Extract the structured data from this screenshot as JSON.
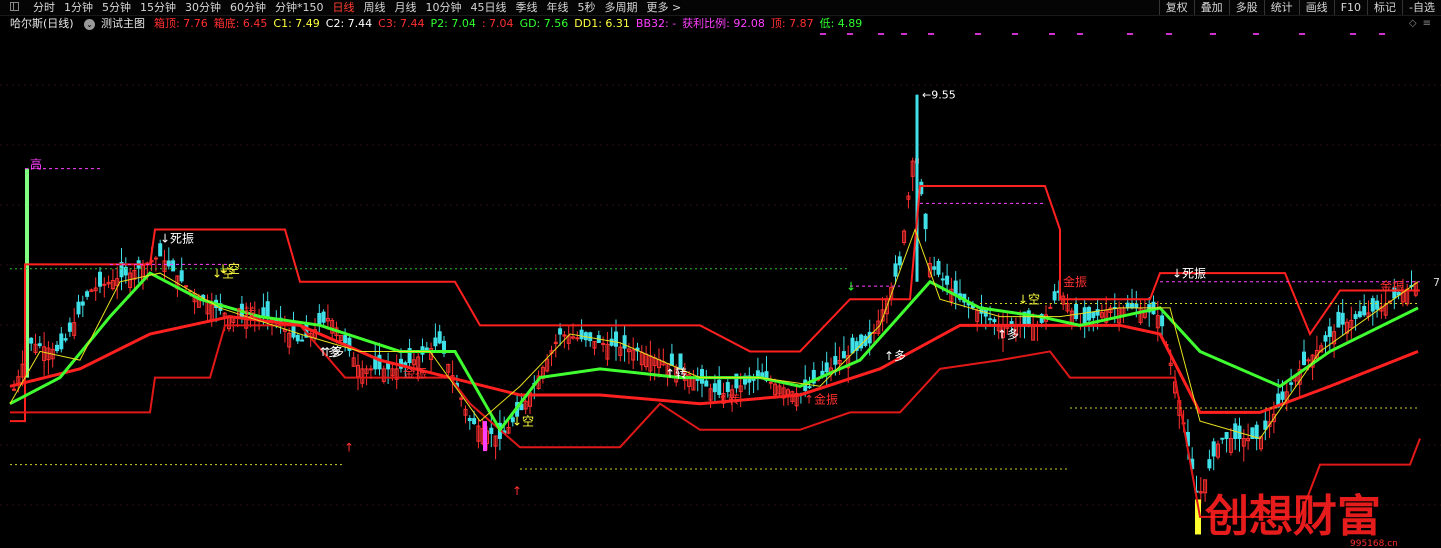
{
  "toolbar": {
    "periods": [
      "分时",
      "1分钟",
      "5分钟",
      "15分钟",
      "30分钟",
      "60分钟",
      "分钟*150",
      "日线",
      "周线",
      "月线",
      "10分钟",
      "45日线",
      "季线",
      "年线",
      "5秒",
      "多周期",
      "更多 >"
    ],
    "active_period": "日线",
    "right_tools": [
      "复权",
      "叠加",
      "多股",
      "统计",
      "画线",
      "F10",
      "标记",
      "-自选"
    ]
  },
  "legend": {
    "stock": "哈尔斯(日线)",
    "main": "测试主图",
    "items": [
      {
        "text": "箱顶: 7.76",
        "color": "#ff3030"
      },
      {
        "text": "箱底: 6.45",
        "color": "#ff3030"
      },
      {
        "text": "C1: 7.49",
        "color": "#ffff40"
      },
      {
        "text": "C2: 7.44",
        "color": "#ffffff"
      },
      {
        "text": "C3: 7.44",
        "color": "#ff3030"
      },
      {
        "text": "P2: 7.04",
        "color": "#30ff30"
      },
      {
        "text": ": 7.04",
        "color": "#ff3030"
      },
      {
        "text": "GD: 7.56",
        "color": "#30ff30"
      },
      {
        "text": "DD1: 6.31",
        "color": "#ffff40"
      },
      {
        "text": "BB32: -",
        "color": "#ff40ff"
      },
      {
        "text": "获利比例: 92.08",
        "color": "#ff40ff"
      },
      {
        "text": "顶: 7.87",
        "color": "#ff3030"
      },
      {
        "text": "低: 4.89",
        "color": "#30ff30"
      }
    ],
    "controls": [
      "◇",
      "≡"
    ]
  },
  "chart_data": {
    "type": "candlestick",
    "high_label": "9.55",
    "axis_value": "7",
    "annotations": [
      {
        "text": "高",
        "color": "#ff40ff"
      },
      {
        "text": "↓死振",
        "color": "#ffffff"
      },
      {
        "text": "↓空",
        "color": "#ffff40"
      },
      {
        "text": "↑多",
        "color": "#ffffff"
      },
      {
        "text": "↓空",
        "color": "#ffff40"
      },
      {
        "text": "↑多",
        "color": "#ffffff"
      },
      {
        "text": "↑多",
        "color": "#ffffff"
      },
      {
        "text": "↓空",
        "color": "#ffff40"
      },
      {
        "text": "↑多",
        "color": "#ffffff"
      },
      {
        "text": "↓死振",
        "color": "#ffffff"
      },
      {
        "text": "金振",
        "color": "#ff3030"
      },
      {
        "text": "金振",
        "color": "#ff3030"
      },
      {
        "text": "↑金振",
        "color": "#ff3030"
      },
      {
        "text": "↑转",
        "color": "#ff3030"
      },
      {
        "text": "↑转",
        "color": "#ff3030"
      },
      {
        "text": "↑转",
        "color": "#ffffff"
      },
      {
        "text": "金振",
        "color": "#ff3030"
      },
      {
        "text": "↓空",
        "color": "#ffff40"
      }
    ],
    "watermark_text": "创想财富",
    "watermark_url": "995168.cn"
  }
}
